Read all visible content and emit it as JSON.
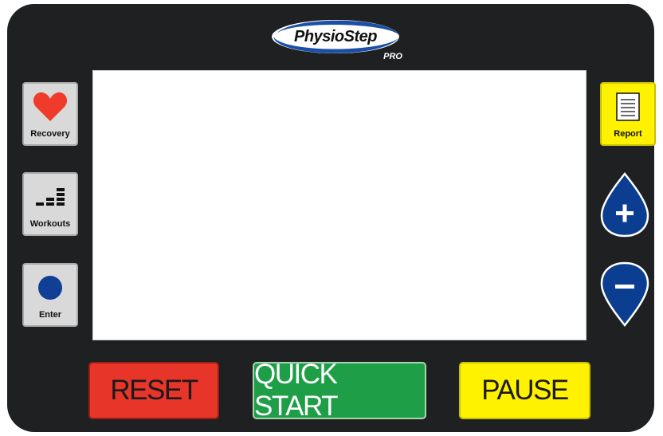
{
  "brand": {
    "name": "PhysioStep",
    "suffix": "PRO"
  },
  "left_buttons": {
    "recovery": {
      "label": "Recovery",
      "icon": "heart-icon"
    },
    "workouts": {
      "label": "Workouts",
      "icon": "bars-icon"
    },
    "enter": {
      "label": "Enter",
      "icon": "circle-icon"
    }
  },
  "right_buttons": {
    "report": {
      "label": "Report",
      "icon": "document-icon"
    },
    "plus": {
      "icon": "plus-icon"
    },
    "minus": {
      "icon": "minus-icon"
    }
  },
  "bottom_buttons": {
    "reset": "RESET",
    "quick_start": "QUICK START",
    "pause": "PAUSE"
  },
  "colors": {
    "console": "#1e2021",
    "reset": "#e8352a",
    "quick_start": "#1e9e47",
    "pause": "#fff200",
    "report": "#fff200",
    "adjust": "#0b3e91",
    "heart": "#ee3b2b",
    "enter_dot": "#123f96"
  }
}
